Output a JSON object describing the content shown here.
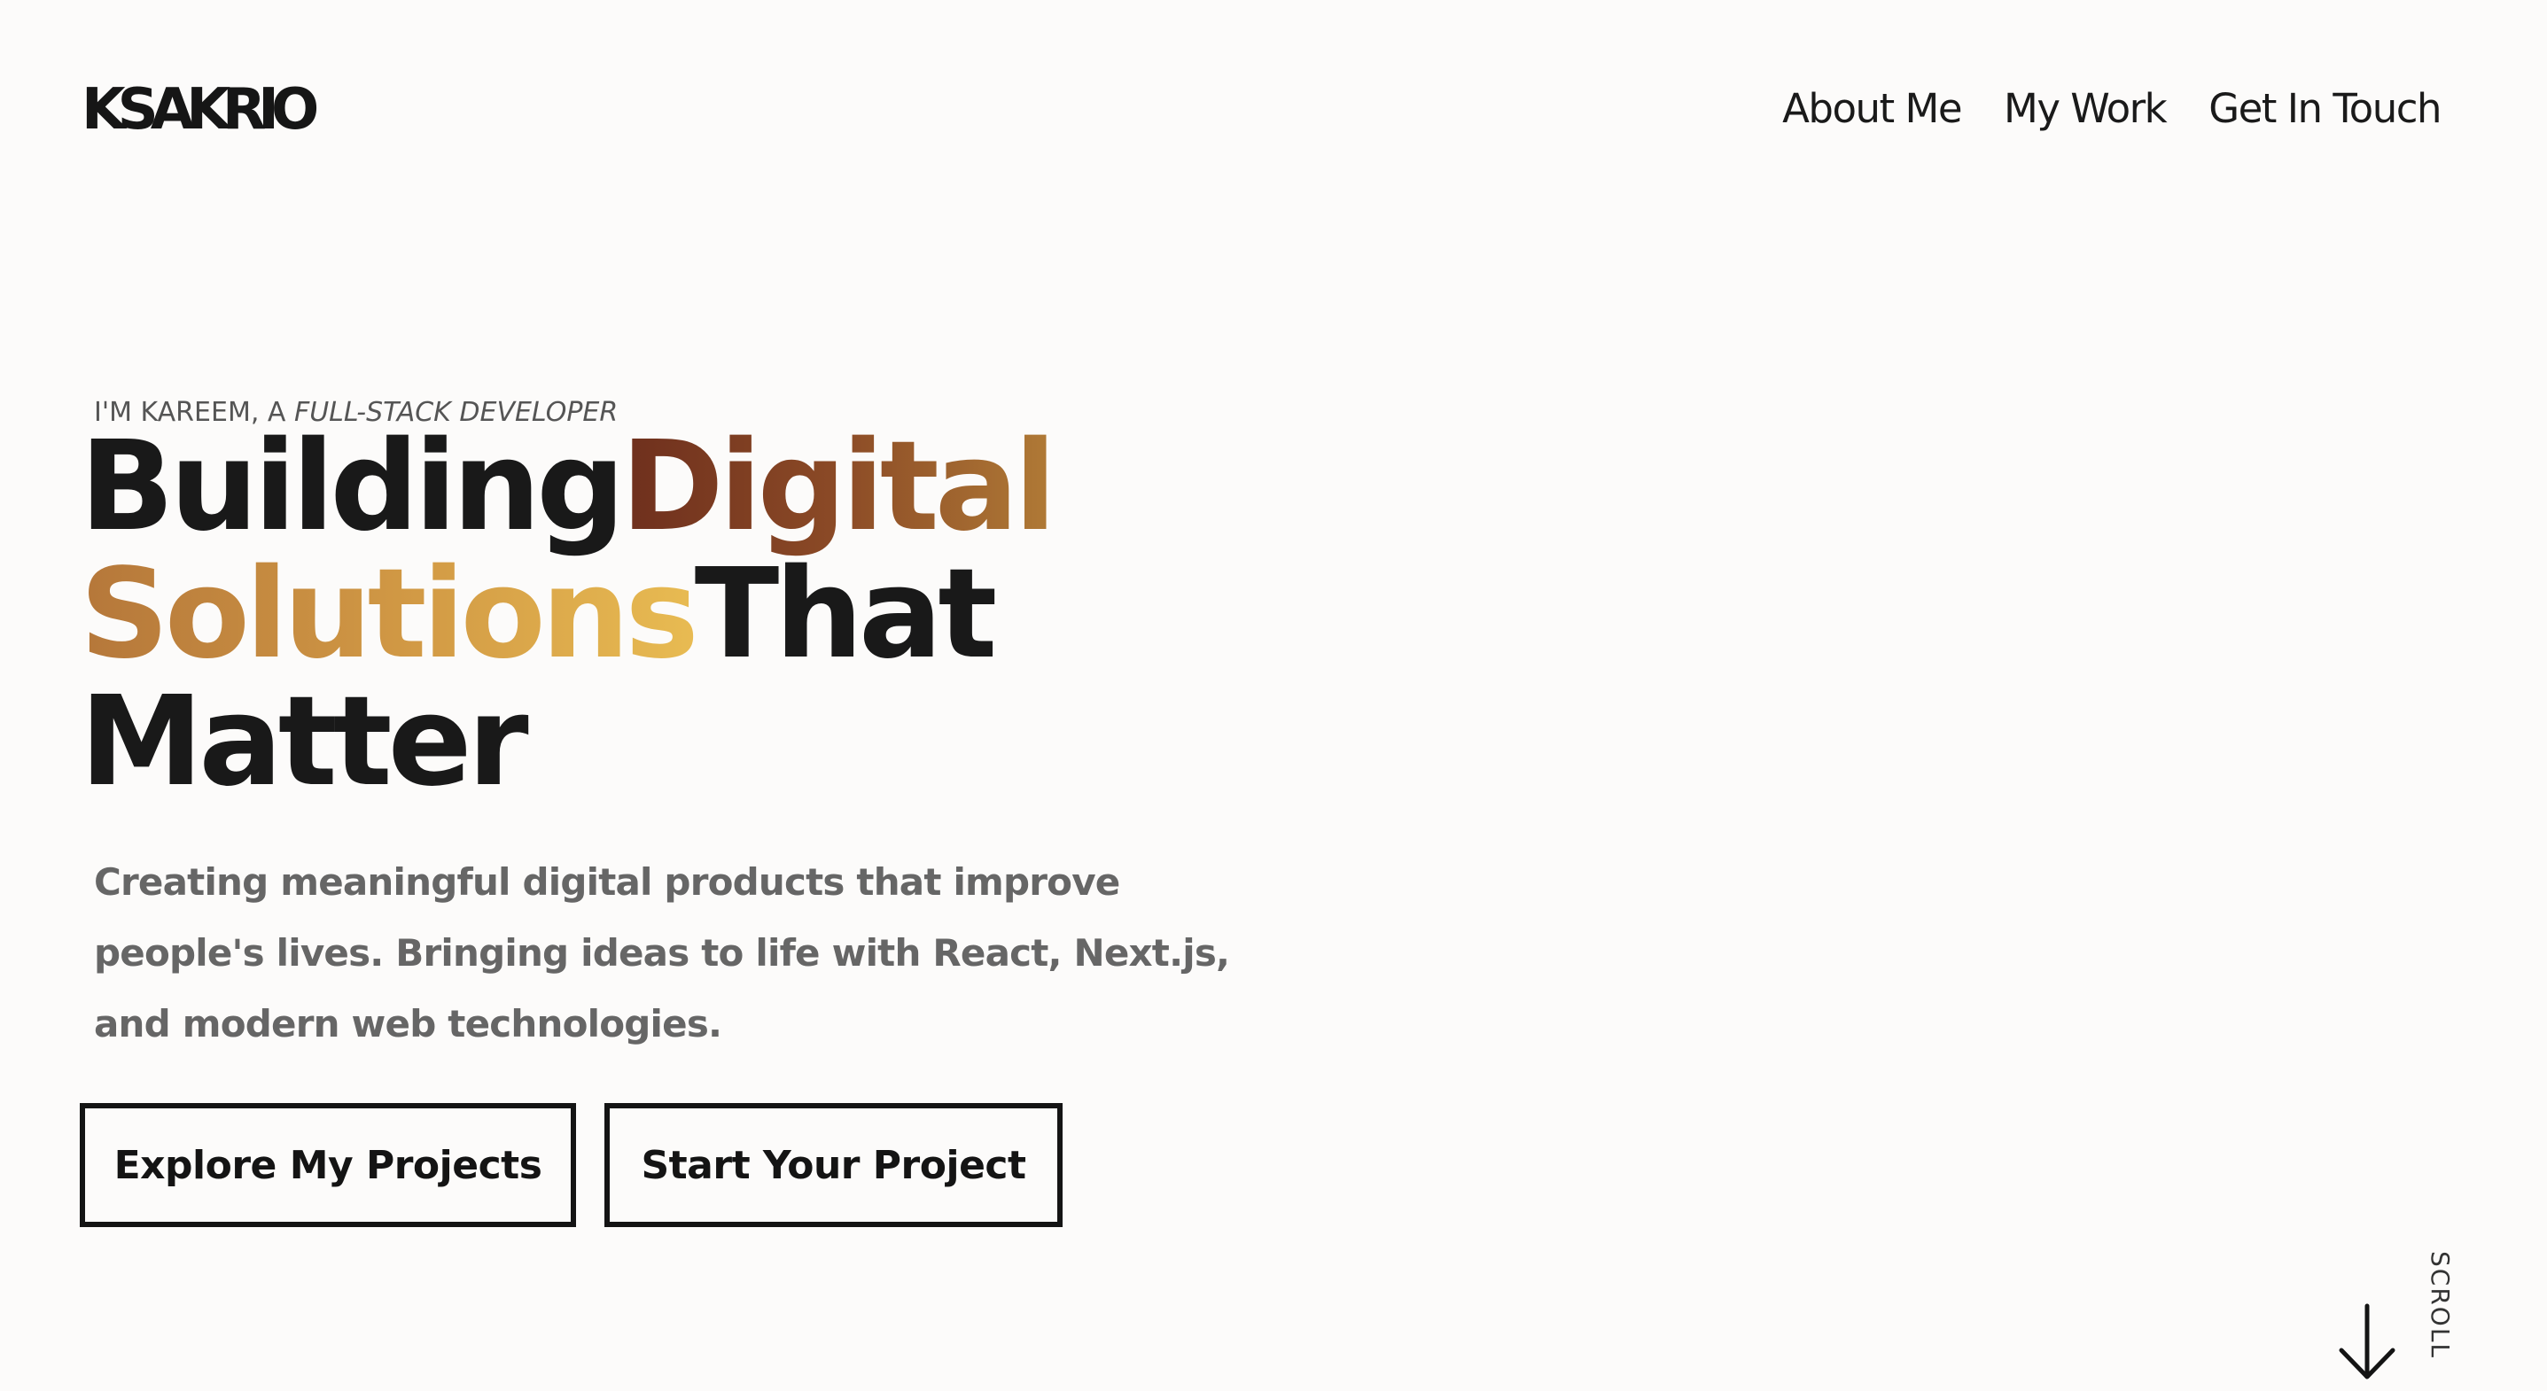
{
  "header": {
    "logo": "KSAKRIO",
    "nav": [
      "About Me",
      "My Work",
      "Get In Touch"
    ]
  },
  "hero": {
    "eyebrow_prefix": "I'M KAREEM, A ",
    "eyebrow_role": "FULL-STACK DEVELOPER",
    "headline": {
      "word1": "Building",
      "word2": "Digital",
      "word3": "Solutions",
      "word4": "That",
      "word5": "Matter"
    },
    "description_lines": [
      "Creating meaningful digital products that improve",
      "people's lives. Bringing ideas to life with React, Next.js,",
      "and modern web technologies."
    ],
    "buttons": {
      "explore": "Explore My Projects",
      "start": "Start Your Project"
    }
  },
  "scroll": {
    "label": "SCROLL",
    "icon": "arrow-down-icon"
  },
  "colors": {
    "background": "#fcfbfa",
    "text": "#191919",
    "muted": "#666666",
    "gradient_digital": [
      "#6e2f1d",
      "#b07a36"
    ],
    "gradient_solutions": [
      "#b5773a",
      "#e8bb52"
    ]
  }
}
